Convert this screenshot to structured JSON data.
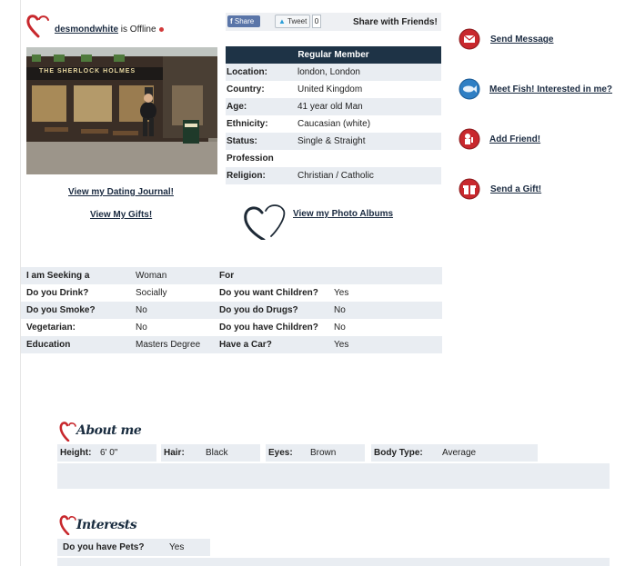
{
  "header": {
    "username": "desmondwhite",
    "status_text": "is Offline"
  },
  "share": {
    "facebook_label": "Share",
    "tweet_label": "Tweet",
    "tweet_count": "0",
    "share_text": "Share with Friends!"
  },
  "details": {
    "heading": "Regular Member",
    "rows": [
      {
        "label": "Location:",
        "value": "london, London"
      },
      {
        "label": "Country:",
        "value": "United Kingdom"
      },
      {
        "label": "Age:",
        "value": "41 year old Man"
      },
      {
        "label": "Ethnicity:",
        "value": "Caucasian (white)"
      },
      {
        "label": "Status:",
        "value": "Single & Straight"
      },
      {
        "label": "Profession",
        "value": ""
      },
      {
        "label": "Religion:",
        "value": "Christian / Catholic"
      }
    ]
  },
  "photo": {
    "pub_sign": "THE SHERLOCK HOLMES"
  },
  "links": {
    "dating_journal": "View my Dating Journal!",
    "my_gifts": "View My Gifts!",
    "photo_albums": "View my Photo Albums"
  },
  "actions": {
    "send_message": "Send Message",
    "meet": "Meet Fish! Interested in me?",
    "add_friend": "Add Friend!",
    "send_gift": "Send a Gift!"
  },
  "seeking": {
    "rows": [
      {
        "k1": "I am Seeking a",
        "v1": "Woman",
        "k2": "For",
        "v2": ""
      },
      {
        "k1": "Do you Drink?",
        "v1": "Socially",
        "k2": "Do you want Children?",
        "v2": "Yes"
      },
      {
        "k1": "Do you Smoke?",
        "v1": "No",
        "k2": "Do you do Drugs?",
        "v2": "No"
      },
      {
        "k1": "Vegetarian:",
        "v1": "No",
        "k2": "Do you have Children?",
        "v2": "No"
      },
      {
        "k1": "Education",
        "v1": "Masters Degree",
        "k2": "Have a Car?",
        "v2": "Yes"
      }
    ]
  },
  "about": {
    "title": "About me",
    "height_label": "Height:",
    "height_value": "6' 0\"",
    "hair_label": "Hair:",
    "hair_value": "Black",
    "eyes_label": "Eyes:",
    "eyes_value": "Brown",
    "body_label": "Body Type:",
    "body_value": "Average"
  },
  "interests": {
    "title": "Interests",
    "pets_label": "Do you have Pets?",
    "pets_value": "Yes"
  },
  "colors": {
    "navy": "#1e3346",
    "row_bg": "#e9edf2",
    "accent_red": "#c8282d",
    "link": "#1a2a40"
  }
}
